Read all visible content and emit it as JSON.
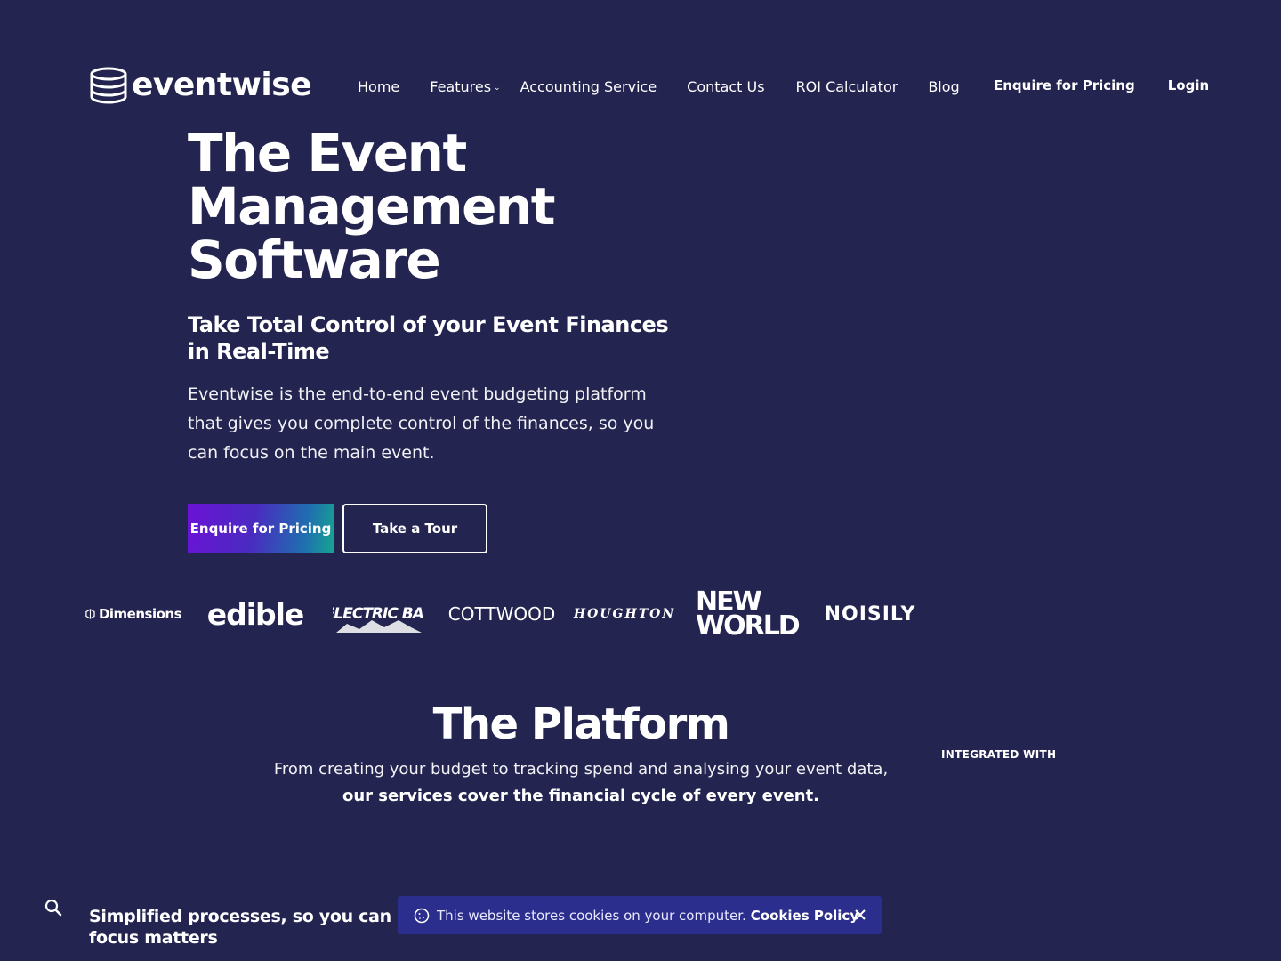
{
  "brand": {
    "name": "eventwise"
  },
  "nav": {
    "items": [
      "Home",
      "Features",
      "Accounting Service",
      "Contact Us",
      "ROI Calculator",
      "Blog"
    ],
    "enquire": "Enquire for Pricing",
    "login": "Login"
  },
  "hero": {
    "title_lines": [
      "The Event",
      "Management",
      "Software"
    ],
    "subtitle": "Take Total Control of your Event Finances in Real-Time",
    "description": "Eventwise is the end-to-end event budgeting platform that gives you complete control of the finances, so you can focus on the main event.",
    "primary_button": "Enquire for Pricing",
    "secondary_button": "Take a Tour"
  },
  "clients": [
    "Dimensions",
    "edible",
    "ELECTRIC BAY",
    "COTTWOOD",
    "HOUGHTON",
    "NEW",
    "WORLD",
    "NOISILY"
  ],
  "platform": {
    "title": "The Platform",
    "line1": "From creating your budget to tracking spend and analysing your event data,",
    "line2": "our services cover the financial cycle of every event.",
    "integrated_label": "INTEGRATED WITH"
  },
  "bottom": {
    "heading": "Simplified processes, so you can focus matters"
  },
  "cookie_banner": {
    "text": "This website stores cookies on your computer.",
    "link": "Cookies Policy"
  },
  "colors": {
    "background": "#23244f",
    "cookie_background": "#2b2e8c",
    "button_gradient_start": "#6b12d6",
    "button_gradient_end": "#17a58f"
  },
  "icons": [
    "logo-stack-icon",
    "chevron-down-icon",
    "search-icon",
    "cookie-icon",
    "close-icon"
  ]
}
